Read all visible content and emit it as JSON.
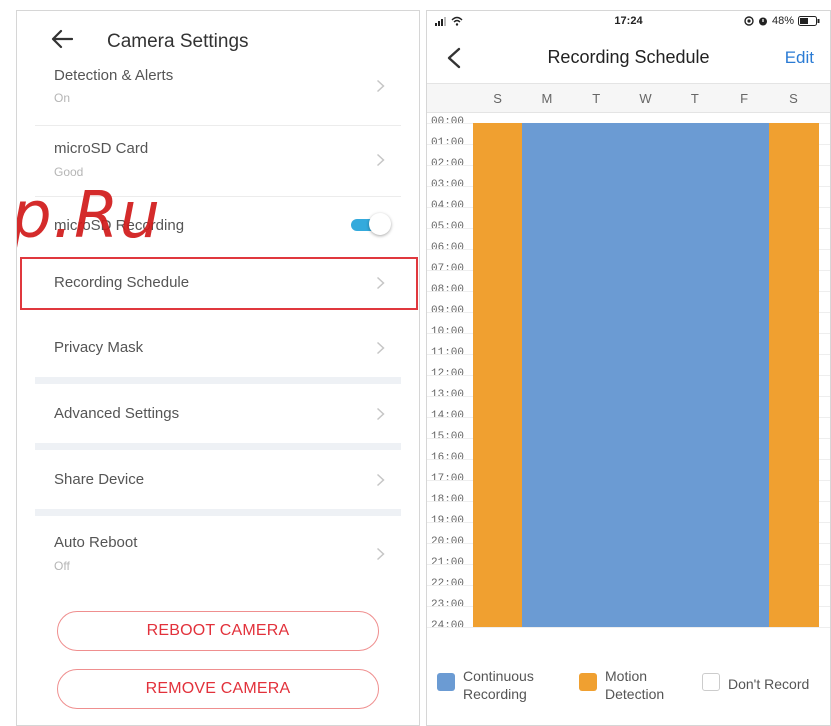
{
  "left": {
    "title": "Camera Settings",
    "rows": [
      {
        "label": "Detection & Alerts",
        "sub": "On"
      },
      {
        "label": "microSD Card",
        "sub": "Good"
      },
      {
        "label": "microSD Recording",
        "toggle_on": true
      },
      {
        "label": "Recording Schedule"
      },
      {
        "label": "Privacy Mask"
      },
      {
        "label": "Advanced Settings"
      },
      {
        "label": "Share Device"
      },
      {
        "label": "Auto Reboot",
        "sub": "Off"
      }
    ],
    "buttons": {
      "reboot": "REBOOT CAMERA",
      "remove": "REMOVE CAMERA"
    },
    "watermark": "p.Ru"
  },
  "right": {
    "status": {
      "time": "17:24",
      "battery": "48%"
    },
    "title": "Recording Schedule",
    "edit": "Edit",
    "days": [
      "S",
      "M",
      "T",
      "W",
      "T",
      "F",
      "S"
    ],
    "hours": [
      "00:00",
      "01:00",
      "02:00",
      "03:00",
      "04:00",
      "05:00",
      "06:00",
      "07:00",
      "08:00",
      "09:00",
      "10:00",
      "11:00",
      "12:00",
      "13:00",
      "14:00",
      "15:00",
      "16:00",
      "17:00",
      "18:00",
      "19:00",
      "20:00",
      "21:00",
      "22:00",
      "23:00",
      "24:00"
    ],
    "schedule": [
      "motion",
      "continuous",
      "continuous",
      "continuous",
      "continuous",
      "continuous",
      "motion"
    ],
    "colors": {
      "continuous": "#6b9bd3",
      "motion": "#f0a030",
      "none": "#ffffff",
      "accent": "#2a7bd4",
      "danger": "#e2313b"
    },
    "legend": {
      "continuous": [
        "Continuous",
        "Recording"
      ],
      "motion": [
        "Motion",
        "Detection"
      ],
      "none": "Don't Record"
    }
  }
}
